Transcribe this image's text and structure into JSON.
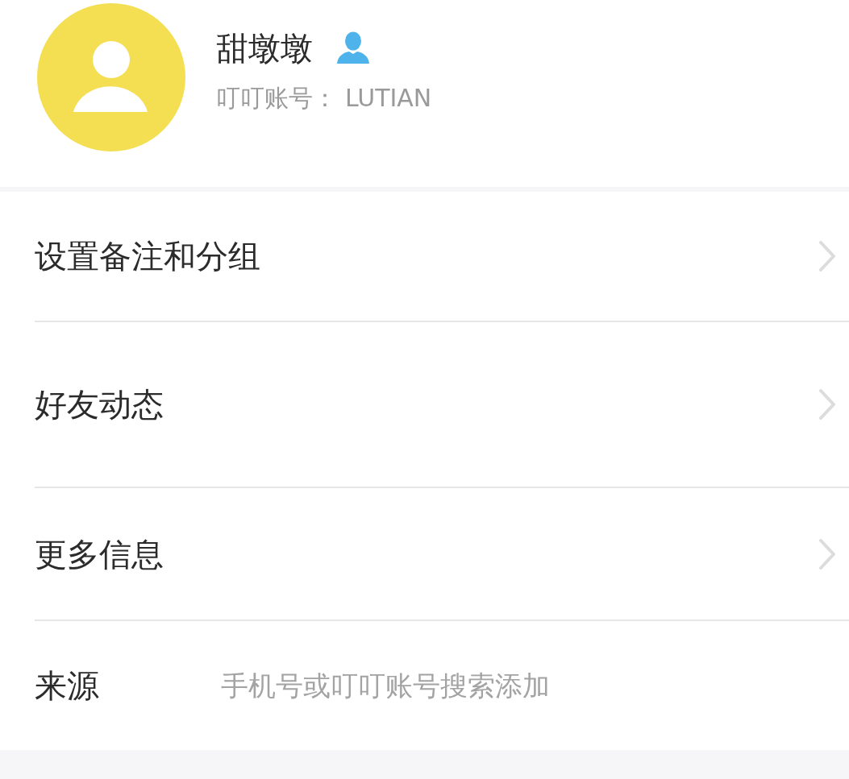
{
  "profile": {
    "name": "甜墩墩",
    "account_label": "叮叮账号：",
    "account_id": "LUTIAN"
  },
  "menu_items": [
    {
      "kind": "link",
      "label": "设置备注和分组"
    },
    {
      "kind": "link",
      "label": "好友动态"
    },
    {
      "kind": "link",
      "label": "更多信息"
    },
    {
      "kind": "info",
      "label": "来源",
      "value": "手机号或叮叮账号搜索添加"
    }
  ]
}
